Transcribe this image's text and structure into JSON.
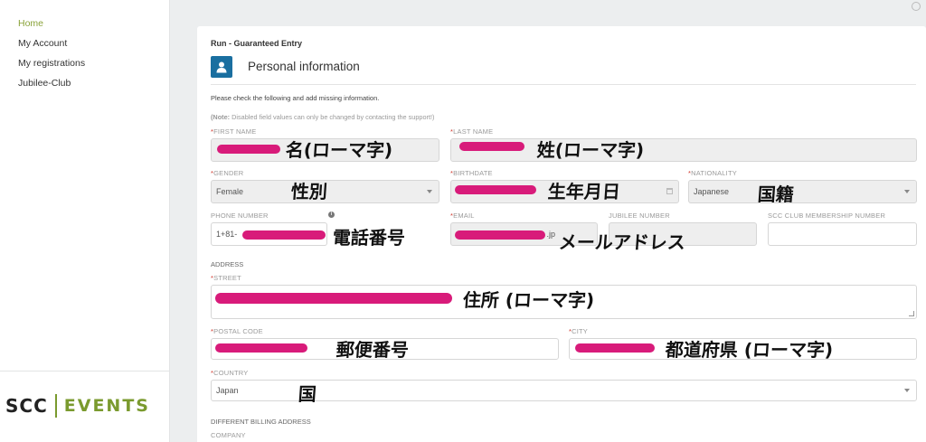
{
  "sidebar": {
    "items": [
      {
        "label": "Home",
        "active": true
      },
      {
        "label": "My Account"
      },
      {
        "label": "My registrations"
      },
      {
        "label": "Jubilee-Club"
      }
    ],
    "logo": {
      "left": "SCC",
      "right": "EVENTS"
    }
  },
  "page": {
    "breadcrumb": "Run - Guaranteed Entry",
    "section_title": "Personal information",
    "intro": "Please check the following and add missing information.",
    "note_prefix": "(Note:",
    "note_text": " Disabled field values can only be changed by contacting the support!)"
  },
  "form": {
    "first_name": {
      "label": "FIRST NAME",
      "required": true,
      "annotation": "名(ローマ字)"
    },
    "last_name": {
      "label": "LAST NAME",
      "required": true,
      "annotation": "姓(ローマ字)"
    },
    "gender": {
      "label": "GENDER",
      "required": true,
      "value": "Female",
      "annotation": "性別"
    },
    "birthdate": {
      "label": "BIRTHDATE",
      "required": true,
      "annotation": "生年月日"
    },
    "nationality": {
      "label": "NATIONALITY",
      "required": true,
      "value": "Japanese",
      "annotation": "国籍"
    },
    "phone": {
      "label": "PHONE NUMBER",
      "value": "1+81-",
      "annotation": "電話番号"
    },
    "email": {
      "label": "EMAIL",
      "required": true,
      "value_suffix": ".jp",
      "annotation": "メールアドレス"
    },
    "jubilee": {
      "label": "JUBILEE NUMBER"
    },
    "club": {
      "label": "SCC CLUB MEMBERSHIP NUMBER"
    },
    "address_heading": "ADDRESS",
    "street": {
      "label": "STREET",
      "required": true,
      "annotation": "住所 (ローマ字)"
    },
    "postal": {
      "label": "POSTAL CODE",
      "required": true,
      "annotation": "郵便番号"
    },
    "city": {
      "label": "CITY",
      "required": true,
      "annotation": "都道府県 (ローマ字)"
    },
    "country": {
      "label": "COUNTRY",
      "required": true,
      "value": "Japan",
      "annotation": "国"
    },
    "billing_heading": "DIFFERENT BILLING ADDRESS",
    "company": {
      "label": "COMPANY"
    }
  },
  "colors": {
    "accent_green": "#7a9a2e",
    "section_icon": "#1a6fa0",
    "required_star": "#d0352a",
    "redaction": "#d81b7a"
  },
  "icons": [
    "user-icon",
    "info-icon",
    "chevron-down-icon",
    "calendar-icon",
    "resize-handle-icon"
  ]
}
